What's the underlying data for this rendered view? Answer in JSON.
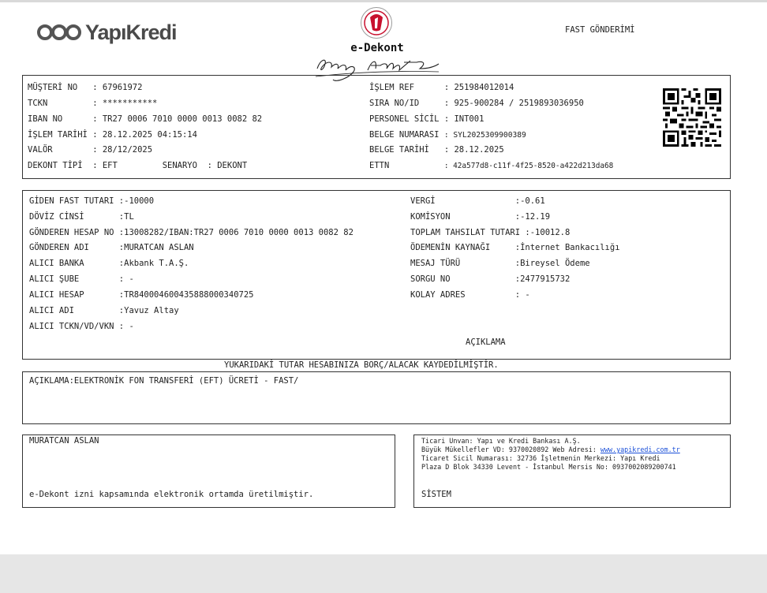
{
  "header": {
    "brand": "YapıKredi",
    "document_title": "e-Dekont",
    "fast_title": "FAST GÖNDERİMİ"
  },
  "top_info": {
    "left": [
      {
        "label": "MÜŞTERİ NO   ",
        "value": ": 67961972"
      },
      {
        "label": "TCKN         ",
        "value": ": ***********"
      },
      {
        "label": "IBAN NO      ",
        "value": ": TR27 0006 7010 0000 0013 0082 82"
      },
      {
        "label": "İŞLEM TARİHİ ",
        "value": ": 28.12.2025 04:15:14"
      },
      {
        "label": "VALÖR        ",
        "value": ": 28/12/2025"
      },
      {
        "label": "DEKONT TİPİ  ",
        "value": ": EFT         SENARYO  : DEKONT"
      }
    ],
    "right": [
      {
        "label": "İŞLEM REF      ",
        "value": ": 251984012014"
      },
      {
        "label": "SIRA NO/ID     ",
        "value": ": 925-900284 / 2519893036950"
      },
      {
        "label": "PERSONEL SİCİL ",
        "value": ": INT001"
      },
      {
        "label": "BELGE NUMARASI ",
        "value": ": SYL2025309900389"
      },
      {
        "label": "BELGE TARİHİ   ",
        "value": ": 28.12.2025"
      },
      {
        "label": "ETTN           ",
        "value": ": 42a577d8-c11f-4f25-8520-a422d213da68"
      }
    ]
  },
  "details": {
    "left": [
      {
        "label": "GİDEN FAST TUTARI ",
        "value": ":-10000"
      },
      {
        "label": "DÖVİZ CİNSİ       ",
        "value": ":TL"
      },
      {
        "label": "GÖNDEREN HESAP NO ",
        "value": ":13008282/IBAN:TR27 0006 7010 0000 0013 0082 82"
      },
      {
        "label": "GÖNDEREN ADI      ",
        "value": ":MURATCAN ASLAN"
      },
      {
        "label": "ALICI BANKA       ",
        "value": ":Akbank T.A.Ş."
      },
      {
        "label": "ALICI ŞUBE        ",
        "value": ": -"
      },
      {
        "label": "ALICI HESAP       ",
        "value": ":TR840004600435888000340725"
      },
      {
        "label": "ALICI ADI         ",
        "value": ":Yavuz Altay"
      },
      {
        "label": "ALICI TCKN/VD/VKN ",
        "value": ": -"
      }
    ],
    "right": [
      {
        "label": "VERGİ                ",
        "value": ":-0.61"
      },
      {
        "label": "KOMİSYON             ",
        "value": ":-12.19"
      },
      {
        "label": "TOPLAM TAHSILAT TUTARI ",
        "value": ":-10012.8"
      },
      {
        "label": "ÖDEMENİN KAYNAĞI     ",
        "value": ":İnternet Bankacılığı"
      },
      {
        "label": "MESAJ TÜRÜ           ",
        "value": ":Bireysel Ödeme"
      },
      {
        "label": "SORGU NO             ",
        "value": ":2477915732"
      },
      {
        "label": "KOLAY ADRES          ",
        "value": ": -"
      }
    ],
    "aciklama_heading": "AÇIKLAMA"
  },
  "notice": "YUKARIDAKİ TUTAR HESABINIZA BORÇ/ALACAK KAYDEDİLMİŞTİR.",
  "description": "AÇIKLAMA:ELEKTRONİK FON TRANSFERİ (EFT) ÜCRETİ - FAST/",
  "footer_left": {
    "name": "MURATCAN ASLAN",
    "note": "e-Dekont izni kapsamında elektronik ortamda üretilmiştir."
  },
  "footer_right": {
    "line1": "Ticari Unvan: Yapı ve Kredi Bankası A.Ş.",
    "line2_prefix": "Büyük Mükellefler VD: 9370020892 Web Adresi: ",
    "website": "www.yapikredi.com.tr",
    "line3": "Ticaret Sicil Numarası: 32736 İşletmenin Merkezi: Yapı Kredi",
    "line4": "Plaza D Blok 34330 Levent - İstanbul Mersis No: 0937002089200741",
    "system_label": "SİSTEM"
  },
  "colors": {
    "logo_gray": "#4a4a4a",
    "seal_red": "#c8102e",
    "link_blue": "#1a4fd8",
    "border": "#333333"
  }
}
